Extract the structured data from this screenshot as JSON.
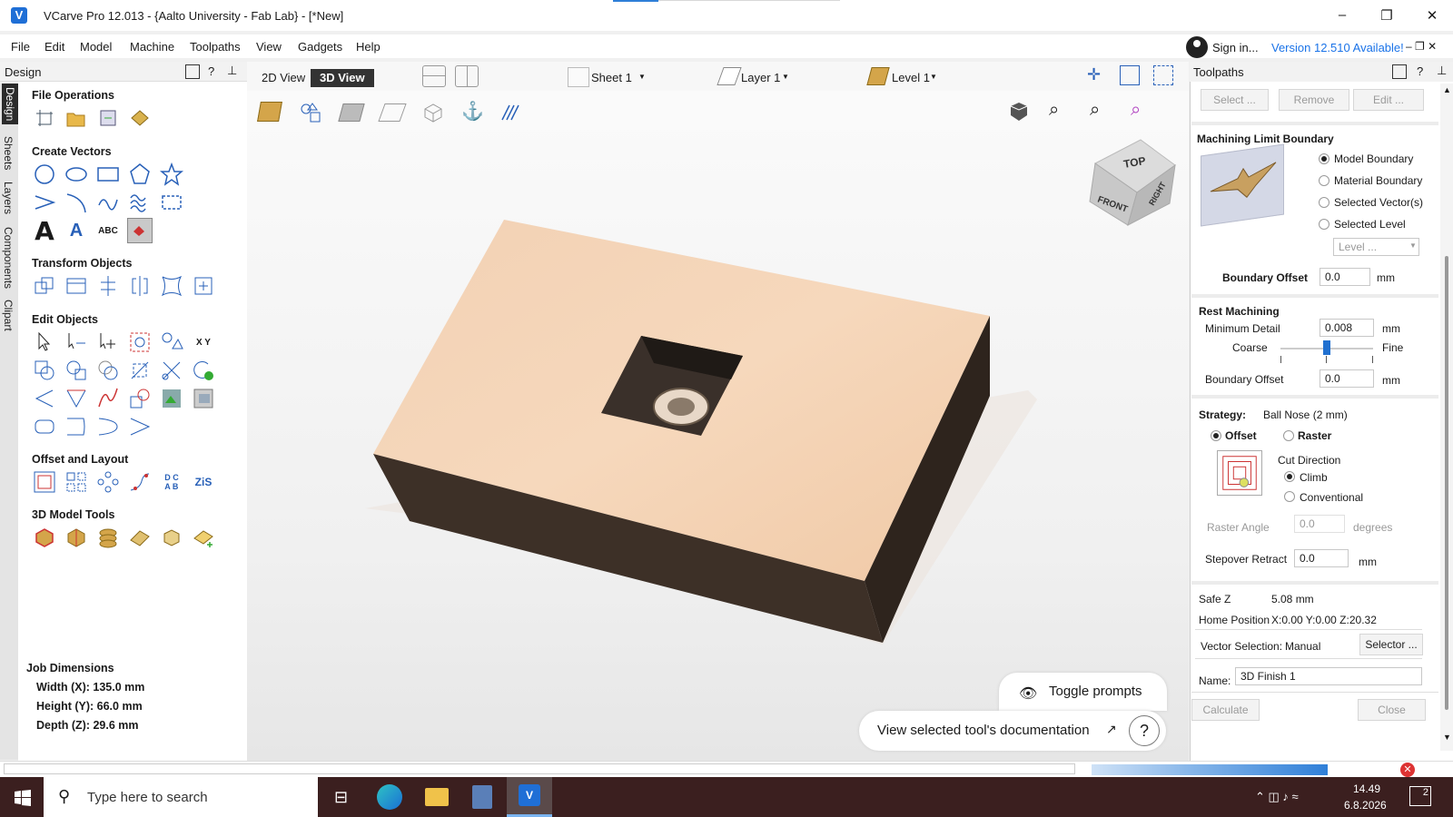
{
  "titlebar": {
    "title": "VCarve Pro 12.013 - {Aalto University - Fab Lab} - [*New]",
    "minimize": "–",
    "maximize": "❐",
    "close": "✕"
  },
  "menu": {
    "items": [
      "File",
      "Edit",
      "Model",
      "Machine",
      "Toolpaths",
      "View",
      "Gadgets",
      "Help"
    ],
    "sign_in": "Sign in...",
    "version": "Version 12.510 Available!"
  },
  "vertical_tabs": [
    "Design",
    "Sheets",
    "Layers",
    "Components",
    "Clipart"
  ],
  "design_panel": {
    "header": "Design",
    "sections": {
      "file_operations": "File Operations",
      "create_vectors": "Create Vectors",
      "transform_objects": "Transform Objects",
      "edit_objects": "Edit Objects",
      "offset_layout": "Offset and Layout",
      "model_tools": "3D Model Tools"
    },
    "job_dimensions": {
      "title": "Job Dimensions",
      "width": "Width  (X): 135.0 mm",
      "height": "Height (Y): 66.0 mm",
      "depth": "Depth  (Z): 29.6 mm"
    }
  },
  "viewport": {
    "tab_2d": "2D View",
    "tab_3d": "3D View",
    "sheet": "Sheet 1",
    "layer": "Layer 1",
    "level": "Level 1",
    "cube_top": "TOP",
    "cube_front": "FRONT",
    "cube_right": "RIGHT",
    "toggle_prompts": "Toggle prompts",
    "doc_link": "View selected tool's documentation",
    "help_glyph": "?"
  },
  "toolpaths": {
    "header": "Toolpaths",
    "btn_select": "Select ...",
    "btn_remove": "Remove",
    "btn_edit": "Edit ...",
    "mlb_title": "Machining Limit Boundary",
    "opt_model": "Model Boundary",
    "opt_material": "Material Boundary",
    "opt_vectors": "Selected Vector(s)",
    "opt_level": "Selected Level",
    "level_dropdown": "Level ...",
    "boundary_offset_label": "Boundary Offset",
    "boundary_offset_value": "0.0",
    "unit_mm": "mm",
    "rest_title": "Rest Machining",
    "min_detail_label": "Minimum Detail",
    "min_detail_value": "0.008",
    "coarse": "Coarse",
    "fine": "Fine",
    "slider_level": 0.5,
    "rest_offset_label": "Boundary Offset",
    "rest_offset_value": "0.0",
    "strategy_label": "Strategy:",
    "strategy_tool": "Ball Nose (2 mm)",
    "opt_offset": "Offset",
    "opt_raster": "Raster",
    "cut_direction": "Cut Direction",
    "opt_climb": "Climb",
    "opt_conventional": "Conventional",
    "raster_angle_label": "Raster Angle",
    "raster_angle_value": "0.0",
    "degrees": "degrees",
    "stepover_label": "Stepover Retract",
    "stepover_value": "0.0",
    "safe_z_label": "Safe Z",
    "safe_z_value": "5.08 mm",
    "home_label": "Home Position",
    "home_value": "X:0.00 Y:0.00 Z:20.32",
    "vector_sel_label": "Vector Selection:",
    "vector_sel_value": "Manual",
    "selector_btn": "Selector ...",
    "name_label": "Name:",
    "name_value": "3D Finish 1",
    "calculate": "Calculate",
    "close": "Close"
  },
  "taskbar": {
    "search_placeholder": "Type here to search",
    "time": "14.49",
    "date": "6.8.2026",
    "notif_count": "2"
  }
}
